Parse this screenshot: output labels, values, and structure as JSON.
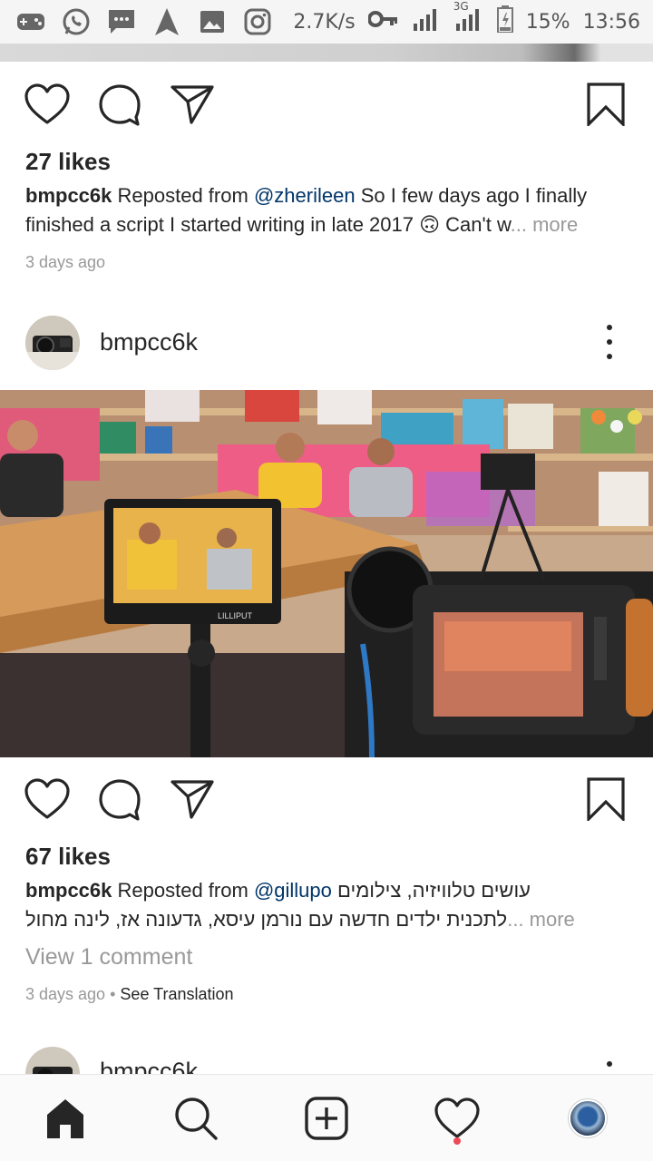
{
  "status_bar": {
    "speed": "2.7K/s",
    "network": "3G",
    "battery": "15%",
    "time": "13:56"
  },
  "post1": {
    "likes": "27 likes",
    "username": "bmpcc6k",
    "reposted_from_label": "Reposted from",
    "mention": "@zherileen",
    "caption": "So I few days ago I finally finished a script I started writing in late 2017 🙃 Can't w",
    "more": "... more",
    "time_ago": "3 days ago"
  },
  "post2": {
    "username": "bmpcc6k",
    "monitor_brand": "LILLIPUT",
    "likes": "67 likes",
    "caption_username": "bmpcc6k",
    "reposted_from_label": "Reposted from",
    "mention": "@gillupo",
    "caption_line1_rtl": "עושים טלוויזיה, צילומים",
    "caption_line2_rtl": "לתכנית ילדים חדשה עם נורמן עיסא, גדעונה אז, לינה מחול",
    "more": "... more",
    "view_comments": "View 1 comment",
    "time_ago": "3 days ago",
    "separator": "•",
    "see_translation": "See Translation"
  },
  "post3_peek": {
    "username": "bmpcc6k"
  },
  "colors": {
    "link": "#003569",
    "muted": "#999999",
    "text": "#262626",
    "notification": "#ed4956"
  }
}
